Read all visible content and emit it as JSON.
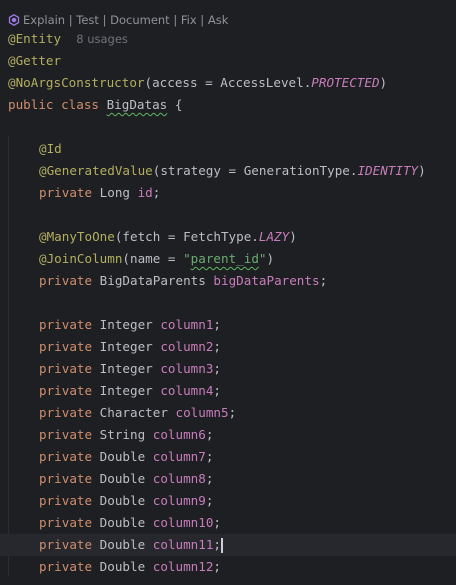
{
  "hint": {
    "actions": "Explain | Test | Document | Fix | Ask",
    "icon": "ai-sparkle-icon"
  },
  "code": {
    "entity": "@Entity",
    "usages": "8 usages",
    "getter": "@Getter",
    "noargs_ann": "@NoArgsConstructor",
    "noargs_open": "(access = AccessLevel.",
    "noargs_const": "PROTECTED",
    "noargs_close": ")",
    "class_kw": "public class",
    "class_name": "BigDatas",
    "class_brace": " {",
    "id_ann": "@Id",
    "gen_ann": "@GeneratedValue",
    "gen_open": "(strategy = GenerationType.",
    "gen_const": "IDENTITY",
    "gen_close": ")",
    "id_kw": "private",
    "id_type": " Long ",
    "id_name": "id",
    "id_semi": ";",
    "m2o_ann": "@ManyToOne",
    "m2o_open": "(fetch = FetchType.",
    "m2o_const": "LAZY",
    "m2o_close": ")",
    "join_ann": "@JoinColumn",
    "join_open": "(name = ",
    "join_q1": "\"",
    "join_val": "parent_id",
    "join_q2": "\"",
    "join_close": ")",
    "parent_kw": "private",
    "parent_type": " BigDataParents ",
    "parent_name": "bigDataParents",
    "parent_semi": ";",
    "columns": [
      {
        "kw": "private",
        "type": " Integer ",
        "name": "column1",
        "semi": ";"
      },
      {
        "kw": "private",
        "type": " Integer ",
        "name": "column2",
        "semi": ";"
      },
      {
        "kw": "private",
        "type": " Integer ",
        "name": "column3",
        "semi": ";"
      },
      {
        "kw": "private",
        "type": " Integer ",
        "name": "column4",
        "semi": ";"
      },
      {
        "kw": "private",
        "type": " Character ",
        "name": "column5",
        "semi": ";"
      },
      {
        "kw": "private",
        "type": " String ",
        "name": "column6",
        "semi": ";"
      },
      {
        "kw": "private",
        "type": " Double ",
        "name": "column7",
        "semi": ";"
      },
      {
        "kw": "private",
        "type": " Double ",
        "name": "column8",
        "semi": ";"
      },
      {
        "kw": "private",
        "type": " Double ",
        "name": "column9",
        "semi": ";"
      },
      {
        "kw": "private",
        "type": " Double ",
        "name": "column10",
        "semi": ";"
      },
      {
        "kw": "private",
        "type": " Double ",
        "name": "column11",
        "semi": ";"
      },
      {
        "kw": "private",
        "type": " Double ",
        "name": "column12",
        "semi": ";"
      }
    ]
  },
  "colors": {
    "background": "#1e1f22",
    "annotation": "#b3ae60",
    "keyword": "#cf8e6d",
    "field": "#c77dbb",
    "string": "#6aab73"
  }
}
